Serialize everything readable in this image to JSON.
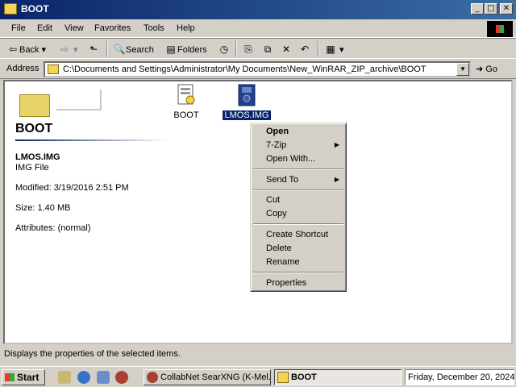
{
  "window": {
    "title": "BOOT",
    "min": "_",
    "max": "□",
    "close": "✕"
  },
  "menu": [
    "File",
    "Edit",
    "View",
    "Favorites",
    "Tools",
    "Help"
  ],
  "toolbar": {
    "back": "Back",
    "search": "Search",
    "folders": "Folders"
  },
  "address": {
    "label": "Address",
    "value": "C:\\Documents and Settings\\Administrator\\My Documents\\New_WinRAR_ZIP_archive\\BOOT",
    "go": "Go"
  },
  "panel": {
    "heading": "BOOT",
    "file_name": "LMOS.IMG",
    "file_type": "IMG File",
    "modified": "Modified: 3/19/2016 2:51 PM",
    "size": "Size: 1.40 MB",
    "attributes": "Attributes: (normal)"
  },
  "files": [
    {
      "name": "BOOT"
    },
    {
      "name": "LMOS.IMG",
      "selected": true
    }
  ],
  "context_menu": {
    "open": "Open",
    "zip": "7-Zip",
    "open_with": "Open With...",
    "send_to": "Send To",
    "cut": "Cut",
    "copy": "Copy",
    "create_shortcut": "Create Shortcut",
    "delete": "Delete",
    "rename": "Rename",
    "properties": "Properties"
  },
  "status": {
    "text": "Displays the properties of the selected items."
  },
  "taskbar": {
    "start": "Start",
    "task1": "CollabNet SearXNG (K-Mel...",
    "task2": "BOOT",
    "clock": "Friday, December 20, 2024"
  },
  "colors": {
    "titlebar": "#0a246a",
    "selection": "#0a246a",
    "face": "#d4d0c8"
  }
}
